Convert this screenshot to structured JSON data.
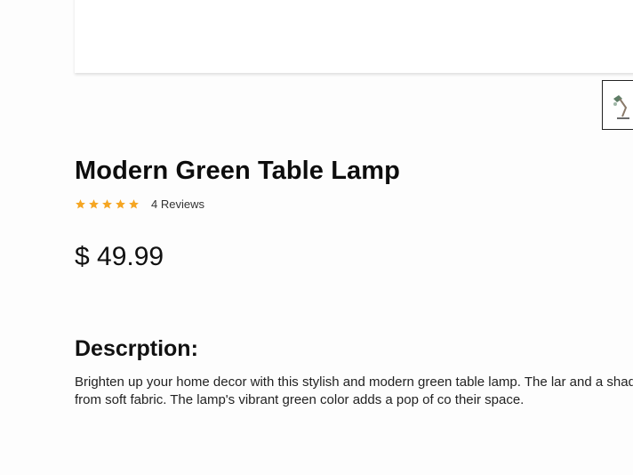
{
  "product": {
    "title": "Modern Green Table Lamp",
    "rating": {
      "stars": 5,
      "max": 5,
      "star_color": "#f5a623",
      "reviews_label": "4 Reviews"
    },
    "price": "$ 49.99",
    "description_heading": "Descrption:",
    "description_text": "Brighten up your home decor with this stylish and modern green table lamp. The lar and a shade made from soft fabric. The lamp's vibrant green color adds a pop of co their space."
  },
  "gallery": {
    "thumbnail_icon": "lamp-thumbnail-image"
  }
}
